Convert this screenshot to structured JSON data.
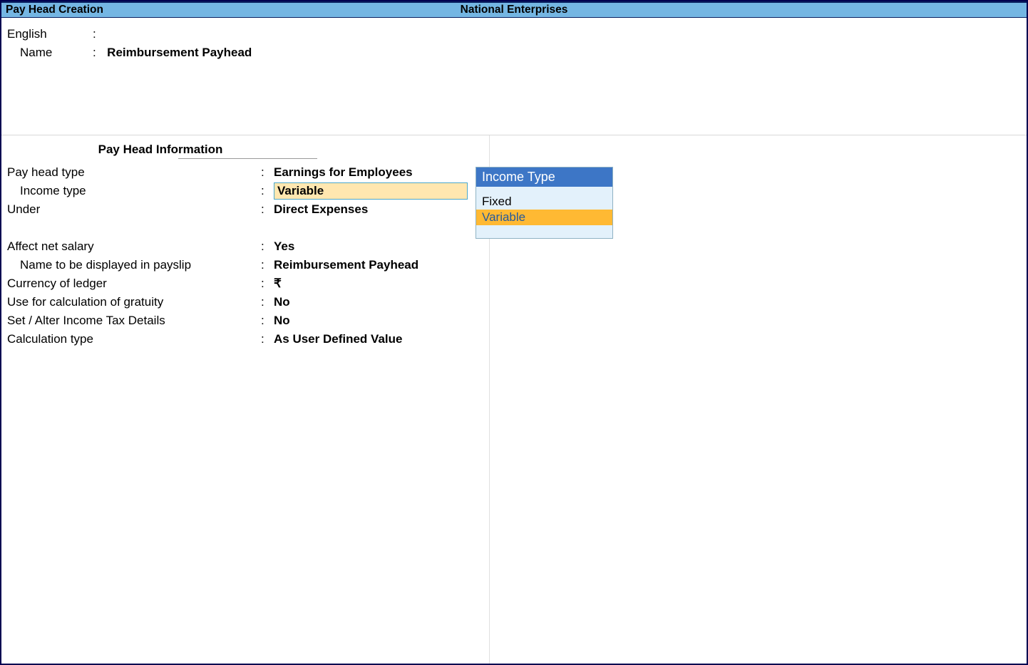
{
  "titlebar": {
    "left": "Pay Head  Creation",
    "center": "National Enterprises"
  },
  "top": {
    "language_label": "English",
    "language_value": "",
    "name_label": "Name",
    "name_value": "Reimbursement Payhead"
  },
  "section": {
    "title": "Pay Head Information"
  },
  "fields": {
    "pay_head_type": {
      "label": "Pay head type",
      "value": "Earnings for Employees"
    },
    "income_type": {
      "label": "Income type",
      "value": "Variable"
    },
    "under": {
      "label": "Under",
      "value": "Direct Expenses"
    },
    "affect_net_salary": {
      "label": "Affect net salary",
      "value": "Yes"
    },
    "payslip_name": {
      "label": "Name to be displayed in payslip",
      "value": "Reimbursement Payhead"
    },
    "currency": {
      "label": "Currency of ledger",
      "value": "₹"
    },
    "gratuity": {
      "label": "Use for calculation of gratuity",
      "value": "No"
    },
    "tax_details": {
      "label": "Set / Alter Income Tax Details",
      "value": "No"
    },
    "calc_type": {
      "label": "Calculation type",
      "value": "As User Defined Value"
    }
  },
  "dropdown": {
    "title": "Income Type",
    "options": [
      "Fixed",
      "Variable"
    ],
    "selected": "Variable"
  }
}
